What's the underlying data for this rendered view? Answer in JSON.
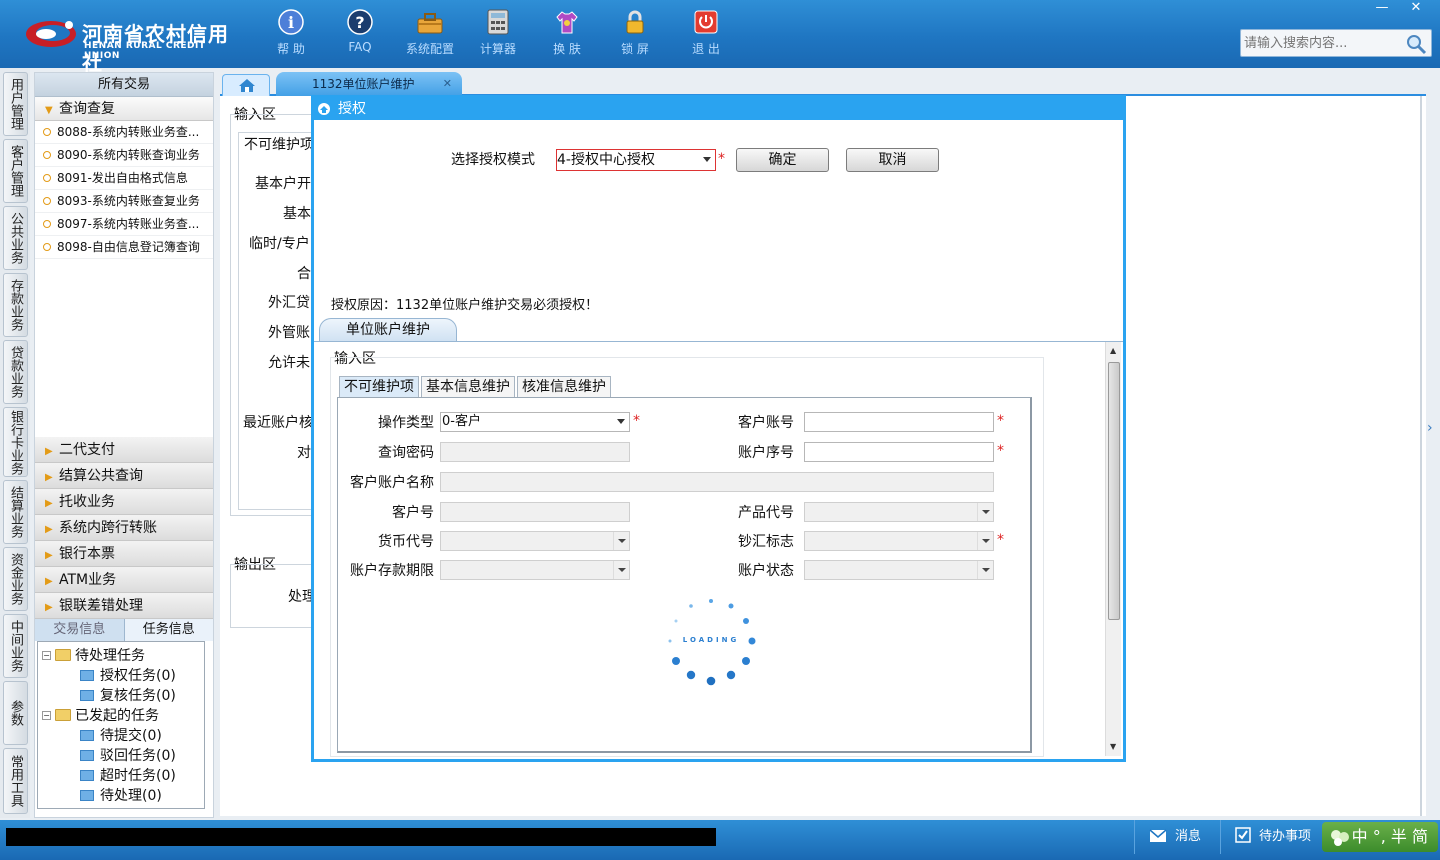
{
  "app": {
    "logo_cn": "河南省农村信用社",
    "logo_en": "HENAN RURAL CREDIT UNION"
  },
  "toolbar": [
    {
      "label": "帮 助",
      "icon": "info-icon"
    },
    {
      "label": "FAQ",
      "icon": "question-icon"
    },
    {
      "label": "系统配置",
      "icon": "toolbox-icon"
    },
    {
      "label": "计算器",
      "icon": "calculator-icon"
    },
    {
      "label": "换 肤",
      "icon": "shirt-icon"
    },
    {
      "label": "锁 屏",
      "icon": "lock-icon"
    },
    {
      "label": "退 出",
      "icon": "power-icon"
    }
  ],
  "window": {
    "minimize": "—",
    "close": "✕"
  },
  "search": {
    "placeholder": "请输入搜索内容..."
  },
  "vertical_tabs": [
    "用户管理",
    "客户管理",
    "公共业务",
    "存款业务",
    "贷款业务",
    "银行卡业务",
    "结算业务",
    "资金业务",
    "中间业务",
    "参数",
    "常用工具"
  ],
  "left_panel": {
    "header": "所有交易",
    "open_group": "查询查复",
    "items": [
      "8088-系统内转账业务查...",
      "8090-系统内转账查询业务",
      "8091-发出自由格式信息",
      "8093-系统内转账查复业务",
      "8097-系统内转账业务查...",
      "8098-自由信息登记簿查询"
    ],
    "groups": [
      "二代支付",
      "结算公共查询",
      "托收业务",
      "系统内跨行转账",
      "银行本票",
      "ATM业务",
      "银联差错处理"
    ],
    "task_tabs": [
      "交易信息",
      "任务信息"
    ],
    "tree": {
      "pending": "待处理任务",
      "pending_children": [
        "授权任务(0)",
        "复核任务(0)"
      ],
      "initiated": "已发起的任务",
      "initiated_children": [
        "待提交(0)",
        "驳回任务(0)",
        "超时任务(0)",
        "待处理(0)"
      ]
    }
  },
  "main_tab": {
    "title": "1132单位账户维护",
    "close": "✕"
  },
  "background_form": {
    "input_area": "输入区",
    "tab_fragment": "不可维护项",
    "labels": [
      "基本户开",
      "基本",
      "临时/专户",
      "合",
      "外汇贷",
      "外管账",
      "允许未",
      "最近账户核",
      "对"
    ],
    "output_area": "输出区",
    "output_label": "处理"
  },
  "dialog": {
    "title": "授权",
    "mode_label": "选择授权模式",
    "mode_value": "4-授权中心授权",
    "required_mark": "*",
    "ok_button": "确定",
    "cancel_button": "取消",
    "reason": "授权原因：1132单位账户维护交易必须授权！",
    "inner_tab": "单位账户维护",
    "input_area": "输入区",
    "form_tabs": [
      "不可维护项",
      "基本信息维护",
      "核准信息维护"
    ],
    "fields": {
      "op_type_label": "操作类型",
      "op_type_value": "0-客户",
      "cust_account_label": "客户账号",
      "query_pwd_label": "查询密码",
      "account_seq_label": "账户序号",
      "account_name_label": "客户账户名称",
      "cust_no_label": "客户号",
      "product_code_label": "产品代号",
      "currency_label": "货币代号",
      "cash_flag_label": "钞汇标志",
      "deposit_term_label": "账户存款期限",
      "account_status_label": "账户状态"
    },
    "loading_text": "LOADING"
  },
  "statusbar": {
    "message": "消息",
    "todo": "待办事项",
    "ime": "中 °, 半 简"
  },
  "colors": {
    "brand_blue": "#1f76c2",
    "dialog_blue": "#2aa3f0",
    "accent_orange": "#e39b17",
    "required_red": "#d22222"
  }
}
